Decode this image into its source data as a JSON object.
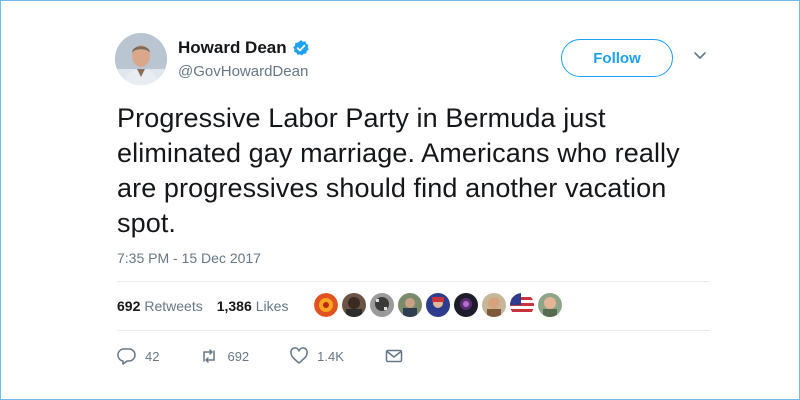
{
  "author": {
    "name": "Howard Dean",
    "handle": "@GovHowardDean",
    "verified": true
  },
  "follow_button": {
    "label": "Follow"
  },
  "tweet": {
    "text": "Progressive Labor Party in Bermuda just eliminated gay marriage. Americans who really are progressives should find another vacation spot.",
    "timestamp": "7:35 PM - 15 Dec 2017"
  },
  "stats": {
    "retweets_count": "692",
    "retweets_label": "Retweets",
    "likes_count": "1,386",
    "likes_label": "Likes"
  },
  "actions": {
    "reply_count": "42",
    "retweet_count": "692",
    "like_count": "1.4K"
  },
  "colors": {
    "accent": "#1da1f2",
    "muted_text": "#657786",
    "divider": "#e6ecf0",
    "frame_border": "#6fbce8"
  }
}
